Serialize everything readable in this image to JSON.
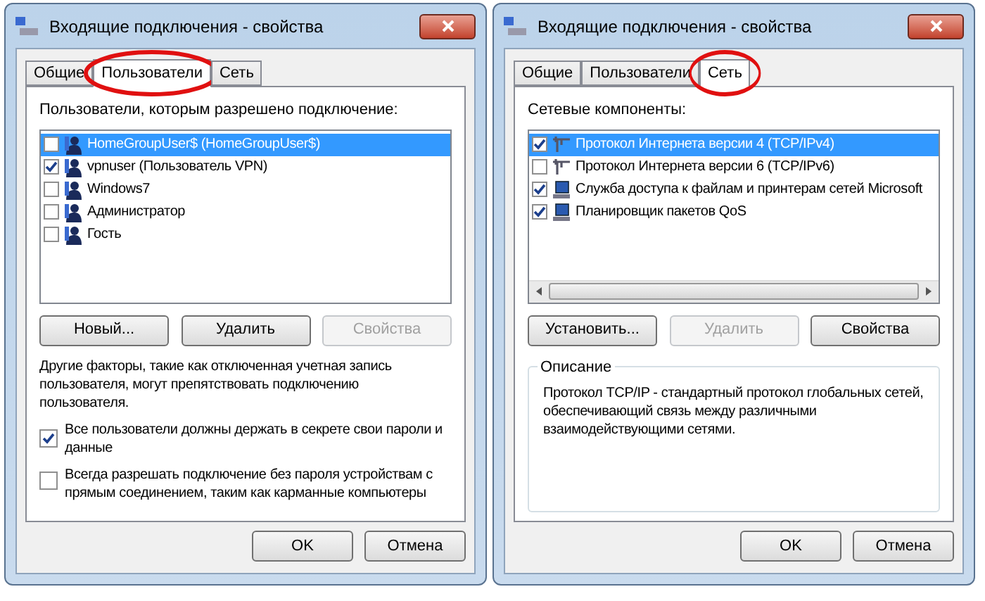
{
  "dialogs": [
    {
      "title": "Входящие подключения - свойства",
      "kind": "users",
      "tabs": [
        {
          "label": "Общие",
          "selected": false,
          "circled": false
        },
        {
          "label": "Пользователи",
          "selected": true,
          "circled": true
        },
        {
          "label": "Сеть",
          "selected": false,
          "circled": false
        }
      ],
      "list_label": "Пользователи, которым разрешено подключение:",
      "items": [
        {
          "label": "HomeGroupUser$ (HomeGroupUser$)",
          "checked": false,
          "selected": true,
          "kind": "user"
        },
        {
          "label": "vpnuser (Пользователь VPN)",
          "checked": true,
          "selected": false,
          "kind": "user"
        },
        {
          "label": "Windows7",
          "checked": false,
          "selected": false,
          "kind": "user"
        },
        {
          "label": "Администратор",
          "checked": false,
          "selected": false,
          "kind": "user"
        },
        {
          "label": "Гость",
          "checked": false,
          "selected": false,
          "kind": "user"
        }
      ],
      "buttons": [
        {
          "label": "Новый...",
          "disabled": false
        },
        {
          "label": "Удалить",
          "disabled": false
        },
        {
          "label": "Свойства",
          "disabled": true
        }
      ],
      "note": "Другие факторы, такие как отключенная учетная запись пользователя, могут препятствовать подключению пользователя.",
      "options": [
        {
          "label": "Все пользователи должны держать в секрете свои пароли и данные",
          "checked": true
        },
        {
          "label": "Всегда разрешать подключение без пароля устройствам с прямым соединением, таким как карманные компьютеры",
          "checked": false
        }
      ],
      "footer_buttons": [
        "OK",
        "Отмена"
      ]
    },
    {
      "title": "Входящие подключения - свойства",
      "kind": "network",
      "tabs": [
        {
          "label": "Общие",
          "selected": false,
          "circled": false
        },
        {
          "label": "Пользователи",
          "selected": false,
          "circled": false
        },
        {
          "label": "Сеть",
          "selected": true,
          "circled": true
        }
      ],
      "list_label": "Сетевые компоненты:",
      "items": [
        {
          "label": "Протокол Интернета версии 4 (TCP/IPv4)",
          "checked": true,
          "selected": true,
          "kind": "protocol"
        },
        {
          "label": "Протокол Интернета версии 6 (TCP/IPv6)",
          "checked": false,
          "selected": false,
          "kind": "protocol"
        },
        {
          "label": "Служба доступа к файлам и принтерам сетей Microsoft",
          "checked": true,
          "selected": false,
          "kind": "service"
        },
        {
          "label": "Планировщик пакетов QoS",
          "checked": true,
          "selected": false,
          "kind": "service"
        }
      ],
      "buttons": [
        {
          "label": "Установить...",
          "disabled": false
        },
        {
          "label": "Удалить",
          "disabled": true
        },
        {
          "label": "Свойства",
          "disabled": false
        }
      ],
      "description": {
        "title": "Описание",
        "text": "Протокол TCP/IP - стандартный протокол глобальных сетей, обеспечивающий связь между различными взаимодействующими сетями."
      },
      "footer_buttons": [
        "OK",
        "Отмена"
      ]
    }
  ]
}
